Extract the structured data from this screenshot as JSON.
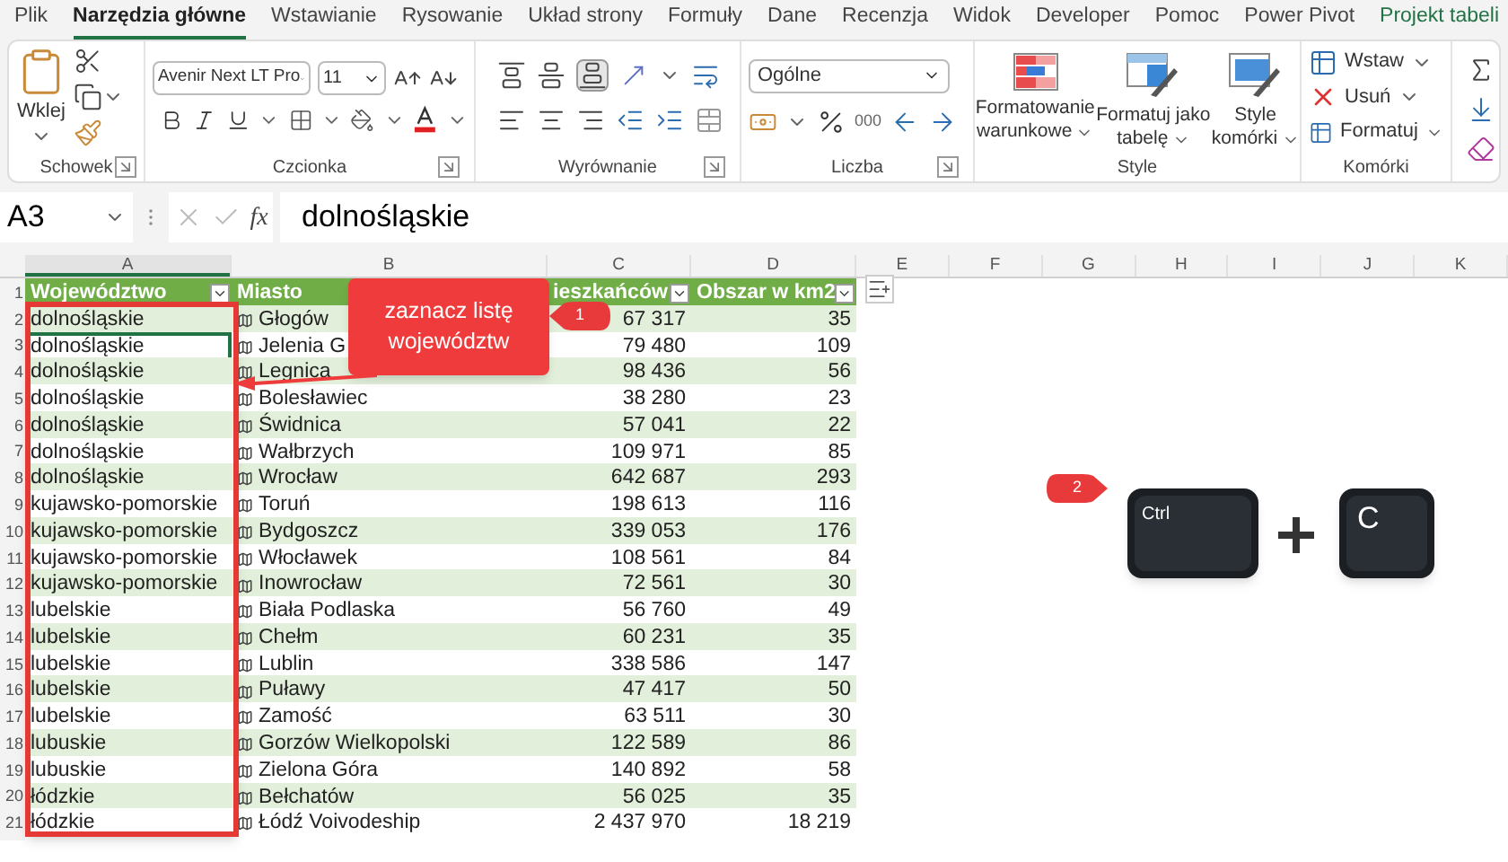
{
  "ribbon_tabs": [
    {
      "label": "Plik",
      "selected": false,
      "contextual": false
    },
    {
      "label": "Narzędzia główne",
      "selected": true,
      "contextual": false
    },
    {
      "label": "Wstawianie",
      "selected": false,
      "contextual": false
    },
    {
      "label": "Rysowanie",
      "selected": false,
      "contextual": false
    },
    {
      "label": "Układ strony",
      "selected": false,
      "contextual": false
    },
    {
      "label": "Formuły",
      "selected": false,
      "contextual": false
    },
    {
      "label": "Dane",
      "selected": false,
      "contextual": false
    },
    {
      "label": "Recenzja",
      "selected": false,
      "contextual": false
    },
    {
      "label": "Widok",
      "selected": false,
      "contextual": false
    },
    {
      "label": "Developer",
      "selected": false,
      "contextual": false
    },
    {
      "label": "Pomoc",
      "selected": false,
      "contextual": false
    },
    {
      "label": "Power Pivot",
      "selected": false,
      "contextual": false
    },
    {
      "label": "Projekt tabeli",
      "selected": false,
      "contextual": true
    }
  ],
  "clipboard": {
    "label": "Schowek",
    "paste": "Wklej"
  },
  "font": {
    "label": "Czcionka",
    "name": "Avenir Next LT Pro",
    "size": "11"
  },
  "alignment": {
    "label": "Wyrównanie"
  },
  "number": {
    "label": "Liczba",
    "format": "Ogólne",
    "thousands": "000"
  },
  "styles": {
    "label": "Style",
    "buttons": [
      {
        "lines": [
          "Formatowanie",
          "warunkowe"
        ],
        "kind": "conditional"
      },
      {
        "lines": [
          "Formatuj jako",
          "tabelę"
        ],
        "kind": "table"
      },
      {
        "lines": [
          "Style",
          "komórki"
        ],
        "kind": "cell"
      }
    ]
  },
  "cells": {
    "label": "Komórki",
    "buttons": [
      {
        "label": "Wstaw",
        "kind": "insert"
      },
      {
        "label": "Usuń",
        "kind": "delete"
      },
      {
        "label": "Formatuj",
        "kind": "format"
      }
    ]
  },
  "formula_bar": {
    "name_box": "A3",
    "function_label": "fx",
    "formula": "dolnośląskie"
  },
  "sheet": {
    "column_letters": [
      "A",
      "B",
      "C",
      "D",
      "E",
      "F",
      "G",
      "H",
      "I",
      "J",
      "K"
    ],
    "row_numbers": [
      "1",
      "2",
      "3",
      "4",
      "5",
      "6",
      "7",
      "8",
      "9",
      "10",
      "11",
      "12",
      "13",
      "14",
      "15",
      "16",
      "17",
      "18",
      "19",
      "20",
      "21"
    ]
  },
  "table": {
    "columns": [
      {
        "label": "Województwo",
        "filter_button": true
      },
      {
        "label": "Miasto",
        "filter_button": false
      },
      {
        "label": "ieszkańców",
        "filter_button": true
      },
      {
        "label": "Obszar w km2",
        "filter_button": true
      }
    ],
    "rows": [
      {
        "cells": [
          "dolnośląskie",
          "Głogów",
          "67 317",
          "35"
        ],
        "active": false
      },
      {
        "cells": [
          "dolnośląskie",
          "Jelenia G",
          "79 480",
          "109"
        ],
        "active": true
      },
      {
        "cells": [
          "dolnośląskie",
          "Legnica",
          "98 436",
          "56"
        ],
        "active": false
      },
      {
        "cells": [
          "dolnośląskie",
          "Bolesławiec",
          "38 280",
          "23"
        ],
        "active": false
      },
      {
        "cells": [
          "dolnośląskie",
          "Świdnica",
          "57 041",
          "22"
        ],
        "active": false
      },
      {
        "cells": [
          "dolnośląskie",
          "Wałbrzych",
          "109 971",
          "85"
        ],
        "active": false
      },
      {
        "cells": [
          "dolnośląskie",
          "Wrocław",
          "642 687",
          "293"
        ],
        "active": false
      },
      {
        "cells": [
          "kujawsko-pomorskie",
          "Toruń",
          "198 613",
          "116"
        ],
        "active": false
      },
      {
        "cells": [
          "kujawsko-pomorskie",
          "Bydgoszcz",
          "339 053",
          "176"
        ],
        "active": false
      },
      {
        "cells": [
          "kujawsko-pomorskie",
          "Włocławek",
          "108 561",
          "84"
        ],
        "active": false
      },
      {
        "cells": [
          "kujawsko-pomorskie",
          "Inowrocław",
          "72 561",
          "30"
        ],
        "active": false
      },
      {
        "cells": [
          "lubelskie",
          "Biała Podlaska",
          "56 760",
          "49"
        ],
        "active": false
      },
      {
        "cells": [
          "lubelskie",
          "Chełm",
          "60 231",
          "35"
        ],
        "active": false
      },
      {
        "cells": [
          "lubelskie",
          "Lublin",
          "338 586",
          "147"
        ],
        "active": false
      },
      {
        "cells": [
          "lubelskie",
          "Puławy",
          "47 417",
          "50"
        ],
        "active": false
      },
      {
        "cells": [
          "lubelskie",
          "Zamość",
          "63 511",
          "30"
        ],
        "active": false
      },
      {
        "cells": [
          "lubuskie",
          "Gorzów Wielkopolski",
          "122 589",
          "86"
        ],
        "active": false
      },
      {
        "cells": [
          "lubuskie",
          "Zielona Góra",
          "140 892",
          "58"
        ],
        "active": false
      },
      {
        "cells": [
          "łódzkie",
          "Bełchatów",
          "56 025",
          "35"
        ],
        "active": false
      },
      {
        "cells": [
          "łódzkie",
          "Łódź Voivodeship",
          "2 437 970",
          "18 219"
        ],
        "active": false
      }
    ]
  },
  "annotations": {
    "callout": "zaznacz listę województw",
    "markers": [
      {
        "label": "1",
        "kind": "point-left"
      },
      {
        "label": "2",
        "kind": "point-right"
      }
    ],
    "keys": [
      "Ctrl",
      "C"
    ]
  }
}
